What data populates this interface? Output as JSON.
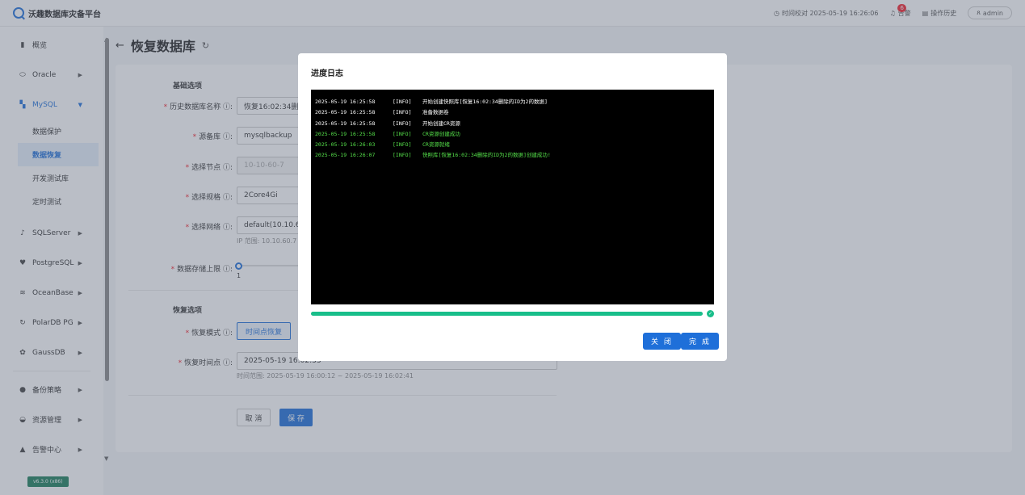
{
  "header": {
    "app_title": "沃趣数据库灾备平台",
    "time_check": "时间校对 2025-05-19 16:26:06",
    "alerts_label": "告警",
    "alerts_count": "6",
    "history_label": "操作历史",
    "user": "admin"
  },
  "sidebar": {
    "items": [
      {
        "label": "概览",
        "icon": "bar-chart-icon"
      },
      {
        "label": "Oracle",
        "icon": "database-icon"
      },
      {
        "label": "MySQL",
        "icon": "mysql-icon"
      },
      {
        "label": "SQLServer",
        "icon": "sqlserver-icon"
      },
      {
        "label": "PostgreSQL",
        "icon": "postgresql-icon"
      },
      {
        "label": "OceanBase",
        "icon": "oceanbase-icon"
      },
      {
        "label": "PolarDB PG",
        "icon": "polardb-icon"
      },
      {
        "label": "GaussDB",
        "icon": "gaussdb-icon"
      },
      {
        "label": "备份策略",
        "icon": "policy-icon"
      },
      {
        "label": "资源管理",
        "icon": "resource-icon"
      },
      {
        "label": "告警中心",
        "icon": "alert-icon"
      }
    ],
    "mysql_sub": [
      "数据保护",
      "数据恢复",
      "开发测试库",
      "定时测试"
    ],
    "version": "v6.3.0 (x86)"
  },
  "page": {
    "title": "恢复数据库"
  },
  "form": {
    "basic_section": "基础选项",
    "restore_section": "恢复选项",
    "history_db_label": "历史数据库名称",
    "history_db_value": "恢复16:02:34删除",
    "source_db_label": "源备库",
    "source_db_value": "mysqlbackup",
    "node_label": "选择节点",
    "node_value": "10-10-60-7",
    "spec_label": "选择规格",
    "spec_value": "2Core4Gi",
    "network_label": "选择网络",
    "network_value": "default(10.10.60.",
    "ip_range_hint": "IP 范围: 10.10.60.7",
    "storage_label": "数据存储上限",
    "storage_value": "1",
    "mode_label": "恢复模式",
    "mode_value": "时间点恢复",
    "time_label": "恢复时间点",
    "time_value": "2025-05-19 16:02:33",
    "time_range_hint": "时间范围: 2025-05-19 16:00:12 ~ 2025-05-19 16:02:41",
    "cancel_label": "取 消",
    "save_label": "保 存"
  },
  "modal": {
    "title": "进度日志",
    "logs": [
      {
        "ts": "2025-05-19 16:25:58",
        "level": "[INFO]",
        "msg": "开始创建快照库[恢复16:02:34删除的ID为2的数据]",
        "status": "white"
      },
      {
        "ts": "2025-05-19 16:25:58",
        "level": "[INFO]",
        "msg": "准备数据卷",
        "status": "white"
      },
      {
        "ts": "2025-05-19 16:25:58",
        "level": "[INFO]",
        "msg": "开始创建CR资源",
        "status": "white"
      },
      {
        "ts": "2025-05-19 16:25:58",
        "level": "[INFO]",
        "msg": "CR资源创建成功",
        "status": "green"
      },
      {
        "ts": "2025-05-19 16:26:03",
        "level": "[INFO]",
        "msg": "CR资源就绪",
        "status": "green"
      },
      {
        "ts": "2025-05-19 16:26:07",
        "level": "[INFO]",
        "msg": "快照库[恢复16:02:34删除的ID为2的数据]创建成功!",
        "status": "green"
      }
    ],
    "progress": 1.0,
    "close_label": "关 闭",
    "finish_label": "完 成"
  },
  "colors": {
    "accent": "#1e6fd9",
    "success": "#19be8a",
    "log_green": "#55e04a"
  }
}
